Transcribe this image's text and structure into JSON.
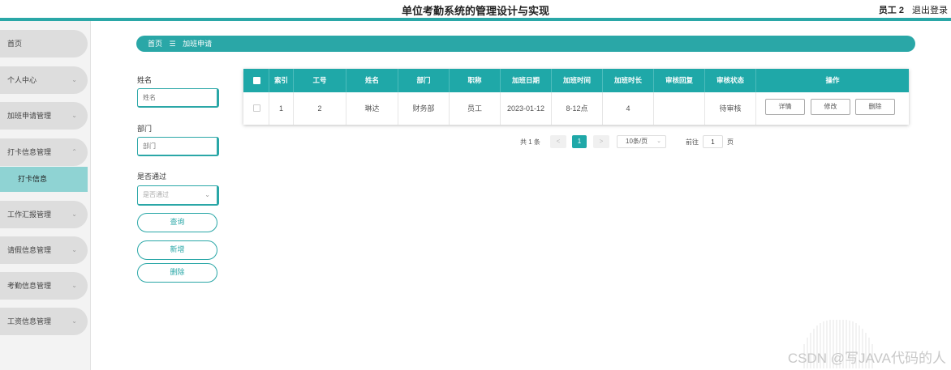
{
  "header": {
    "title": "单位考勤系统的管理设计与实现",
    "user": "员工 2",
    "logout": "退出登录"
  },
  "sidebar": {
    "items": [
      {
        "label": "首页",
        "chevron": ""
      },
      {
        "label": "个人中心",
        "chevron": "⌄"
      },
      {
        "label": "加班申请管理",
        "chevron": "⌄"
      },
      {
        "label": "打卡信息管理",
        "chevron": "⌃"
      },
      {
        "label": "工作汇报管理",
        "chevron": "⌄"
      },
      {
        "label": "请假信息管理",
        "chevron": "⌄"
      },
      {
        "label": "考勤信息管理",
        "chevron": "⌄"
      },
      {
        "label": "工资信息管理",
        "chevron": "⌄"
      }
    ],
    "active_sub": "打卡信息"
  },
  "breadcrumb": {
    "home": "首页",
    "separator": "☰",
    "current": "加班申请"
  },
  "filters": {
    "name_label": "姓名",
    "name_placeholder": "姓名",
    "dept_label": "部门",
    "dept_placeholder": "部门",
    "pass_label": "是否通过",
    "pass_placeholder": "是否通过",
    "query_btn": "查询",
    "add_btn": "新增",
    "delete_btn": "删除"
  },
  "table": {
    "columns": [
      "索引",
      "工号",
      "姓名",
      "部门",
      "职称",
      "加班日期",
      "加班时间",
      "加班时长",
      "审核回复",
      "审核状态",
      "操作"
    ],
    "rows": [
      {
        "index": "1",
        "emp_no": "2",
        "name": "琳达",
        "dept": "财务部",
        "title": "员工",
        "date": "2023-01-12",
        "time": "8-12点",
        "duration": "4",
        "reply": "",
        "status": "待审核"
      }
    ],
    "actions": {
      "detail": "详情",
      "edit": "修改",
      "delete": "删除"
    }
  },
  "pagination": {
    "total": "共 1 条",
    "prev": "<",
    "page": "1",
    "next": ">",
    "page_size": "10条/页",
    "goto_label": "前往",
    "goto_value": "1",
    "goto_suffix": "页"
  },
  "watermark": "CSDN @写JAVA代码的人"
}
